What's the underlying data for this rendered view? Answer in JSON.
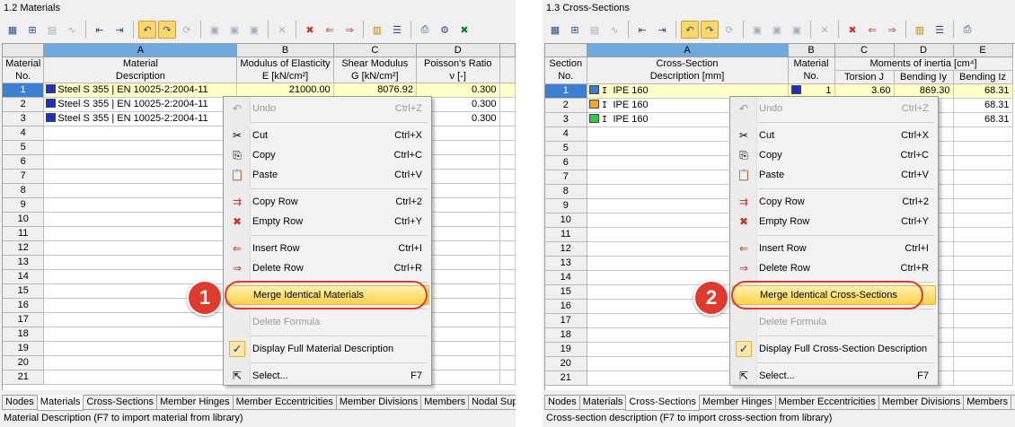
{
  "left": {
    "title": "1.2 Materials",
    "col_letters": [
      "A",
      "B",
      "C",
      "D"
    ],
    "headers": {
      "no": [
        "Material",
        "No."
      ],
      "a": [
        "Material",
        "Description"
      ],
      "b": [
        "Modulus of Elasticity",
        "E [kN/cm²]"
      ],
      "c": [
        "Shear Modulus",
        "G [kN/cm²]"
      ],
      "d": [
        "Poisson's Ratio",
        "ν [-]"
      ]
    },
    "rows": [
      {
        "no": "1",
        "desc": "Steel S 355 | EN 10025-2:2004-11",
        "e": "21000.00",
        "g": "8076.92",
        "nu": "0.300",
        "swatch": "#1f2fbf"
      },
      {
        "no": "2",
        "desc": "Steel S 355 | EN 10025-2:2004-11",
        "e": "",
        "g": "",
        "nu": "0.300",
        "swatch": "#1f2fbf"
      },
      {
        "no": "3",
        "desc": "Steel S 355 | EN 10025-2:2004-11",
        "e": "",
        "g": "",
        "nu": "0.300",
        "swatch": "#1f2fbf"
      }
    ],
    "empty_rows": [
      "4",
      "5",
      "6",
      "7",
      "8",
      "9",
      "10",
      "11",
      "12",
      "13",
      "14",
      "15",
      "16",
      "17",
      "18",
      "19",
      "20",
      "21"
    ],
    "tabs": [
      "Nodes",
      "Materials",
      "Cross-Sections",
      "Member Hinges",
      "Member Eccentricities",
      "Member Divisions",
      "Members",
      "Nodal Supp"
    ],
    "active_tab": "Materials",
    "status": "Material Description (F7 to import material from library)",
    "menu": {
      "undo": "Undo",
      "undo_sc": "Ctrl+Z",
      "cut": "Cut",
      "cut_sc": "Ctrl+X",
      "copy": "Copy",
      "copy_sc": "Ctrl+C",
      "paste": "Paste",
      "paste_sc": "Ctrl+V",
      "copy_row": "Copy Row",
      "copy_row_sc": "Ctrl+2",
      "empty_row": "Empty Row",
      "empty_row_sc": "Ctrl+Y",
      "insert_row": "Insert Row",
      "insert_row_sc": "Ctrl+I",
      "delete_row": "Delete Row",
      "delete_row_sc": "Ctrl+R",
      "merge": "Merge Identical Materials",
      "delete_formula": "Delete Formula",
      "display_full": "Display Full Material Description",
      "select": "Select...",
      "select_sc": "F7"
    },
    "badge": "1"
  },
  "right": {
    "title": "1.3 Cross-Sections",
    "col_letters": [
      "A",
      "B",
      "C",
      "D",
      "E"
    ],
    "headers": {
      "no": [
        "Section",
        "No."
      ],
      "a": [
        "Cross-Section",
        "Description [mm]"
      ],
      "b": [
        "Material",
        "No."
      ],
      "moi": "Moments of inertia [cm⁴]",
      "c": "Torsion J",
      "d": "Bending Iy",
      "e": "Bending Iz"
    },
    "rows": [
      {
        "no": "1",
        "desc": "IPE 160",
        "mat": "1",
        "j": "3.60",
        "iy": "869.30",
        "iz": "68.31",
        "swatch": "#3a7bd5"
      },
      {
        "no": "2",
        "desc": "IPE 160",
        "mat": "",
        "j": "",
        "iy": "",
        "iz": "68.31",
        "swatch": "#f5a623"
      },
      {
        "no": "3",
        "desc": "IPE 160",
        "mat": "",
        "j": "",
        "iy": "",
        "iz": "68.31",
        "swatch": "#2ecc40"
      }
    ],
    "empty_rows": [
      "4",
      "5",
      "6",
      "7",
      "8",
      "9",
      "10",
      "11",
      "12",
      "13",
      "14",
      "15",
      "16",
      "17",
      "18",
      "19",
      "20",
      "21"
    ],
    "tabs": [
      "Nodes",
      "Materials",
      "Cross-Sections",
      "Member Hinges",
      "Member Eccentricities",
      "Member Divisions",
      "Members",
      "No"
    ],
    "active_tab": "Cross-Sections",
    "status": "Cross-section description (F7 to import cross-section from library)",
    "menu": {
      "undo": "Undo",
      "undo_sc": "Ctrl+Z",
      "cut": "Cut",
      "cut_sc": "Ctrl+X",
      "copy": "Copy",
      "copy_sc": "Ctrl+C",
      "paste": "Paste",
      "paste_sc": "Ctrl+V",
      "copy_row": "Copy Row",
      "copy_row_sc": "Ctrl+2",
      "empty_row": "Empty Row",
      "empty_row_sc": "Ctrl+Y",
      "insert_row": "Insert Row",
      "insert_row_sc": "Ctrl+I",
      "delete_row": "Delete Row",
      "delete_row_sc": "Ctrl+R",
      "merge": "Merge Identical Cross-Sections",
      "delete_formula": "Delete Formula",
      "display_full": "Display Full Cross-Section Description",
      "select": "Select...",
      "select_sc": "F7"
    },
    "badge": "2"
  },
  "colors": {
    "accent": "#3d7fd1",
    "highlight": "#ffd24a",
    "badge": "#e03a2e",
    "selected_row": "#ffffc8"
  }
}
